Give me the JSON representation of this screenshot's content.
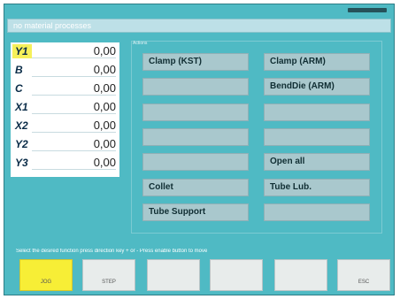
{
  "window": {
    "title": "",
    "message": "no material processes"
  },
  "axes": [
    {
      "name": "Y1",
      "value": "0,00",
      "active": true
    },
    {
      "name": "B",
      "value": "0,00",
      "active": false
    },
    {
      "name": "C",
      "value": "0,00",
      "active": false
    },
    {
      "name": "X1",
      "value": "0,00",
      "active": false
    },
    {
      "name": "X2",
      "value": "0,00",
      "active": false
    },
    {
      "name": "Y2",
      "value": "0,00",
      "active": false
    },
    {
      "name": "Y3",
      "value": "0,00",
      "active": false
    }
  ],
  "panel": {
    "label": "Actions",
    "left_buttons": [
      "Clamp (KST)",
      "",
      "",
      "",
      "",
      "Collet",
      "Tube Support"
    ],
    "right_buttons": [
      "Clamp (ARM)",
      "BendDie (ARM)",
      "",
      "",
      "Open all",
      "Tube Lub.",
      ""
    ]
  },
  "hint": "Select the desired function press direction key + or - Press enable button to move",
  "function_keys": [
    {
      "label": "JOG",
      "active": true
    },
    {
      "label": "STEP",
      "active": false
    },
    {
      "label": "",
      "active": false
    },
    {
      "label": "",
      "active": false
    },
    {
      "label": "",
      "active": false
    },
    {
      "label": "ESC",
      "active": false
    }
  ],
  "colors": {
    "background": "#4fbac4",
    "active_key": "#f7ee36",
    "button": "#a9c8cd"
  }
}
